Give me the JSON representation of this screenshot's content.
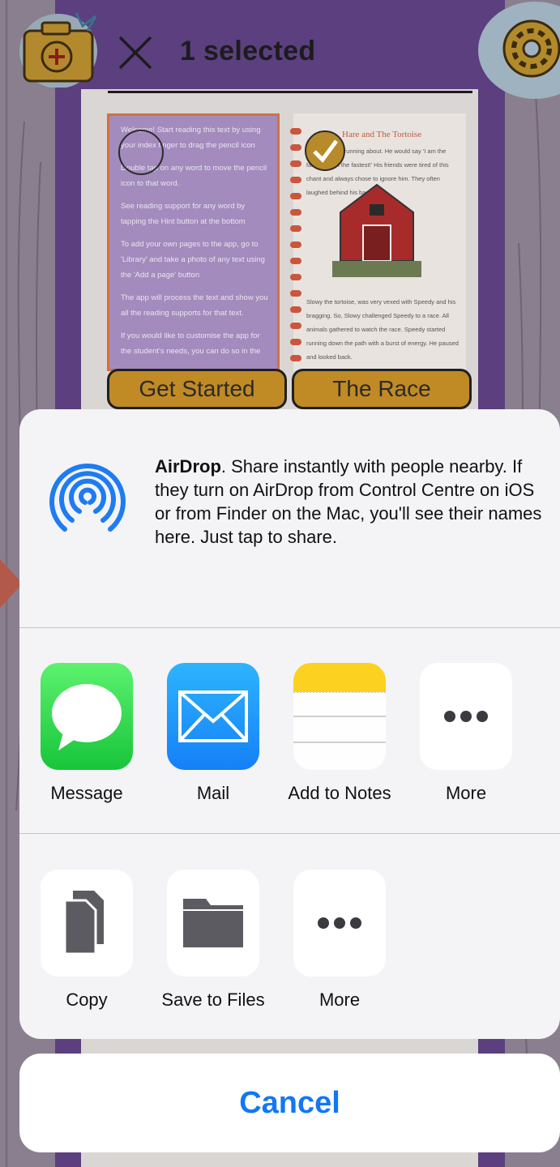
{
  "header": {
    "selected_label": "1 selected"
  },
  "cards": [
    {
      "label": "Get Started",
      "lines": [
        "Welcome! Start reading this text by using your index finger to drag the pencil icon",
        "Double tap on any word to move the pencil icon to that word.",
        "See reading support for any word by tapping the Hint button at the bottom",
        "To add your own pages to the app, go to 'Library' and take a photo of any text using the 'Add a page' button",
        "The app will process the text and show you all the reading supports for that text.",
        "If you would like to customise the app for the student's needs, you can do so in the"
      ]
    },
    {
      "label": "The Race",
      "title": "Hare and The Tortoise",
      "text_top": "...was always running about. He would say 'I am the fastest, I am the fastest!' His friends were tired of this chant and always chose to ignore him. They often laughed behind his back.",
      "text_bottom": "Slowy the tortoise, was very vexed with Speedy and his bragging. So, Slowy challenged Speedy to a race. All animals gathered to watch the race. Speedy started running down the path with a burst of energy. He paused and looked back."
    }
  ],
  "share_sheet": {
    "airdrop": {
      "title": "AirDrop",
      "description": ". Share instantly with people nearby. If they turn on AirDrop from Control Centre on iOS or from Finder on the Mac, you'll see their names here. Just tap to share."
    },
    "apps": [
      {
        "label": "Message",
        "icon": "message-icon"
      },
      {
        "label": "Mail",
        "icon": "mail-icon"
      },
      {
        "label": "Add to Notes",
        "icon": "notes-icon"
      },
      {
        "label": "More",
        "icon": "more-icon"
      }
    ],
    "actions": [
      {
        "label": "Copy",
        "icon": "copy-icon"
      },
      {
        "label": "Save to Files",
        "icon": "folder-icon"
      },
      {
        "label": "More",
        "icon": "more-icon"
      }
    ],
    "cancel_label": "Cancel"
  },
  "colors": {
    "accent": "#1277f7",
    "card_label_bg": "#c08a25",
    "frame_purple": "#5b3f7f",
    "airdrop_blue": "#1d7cf2"
  }
}
